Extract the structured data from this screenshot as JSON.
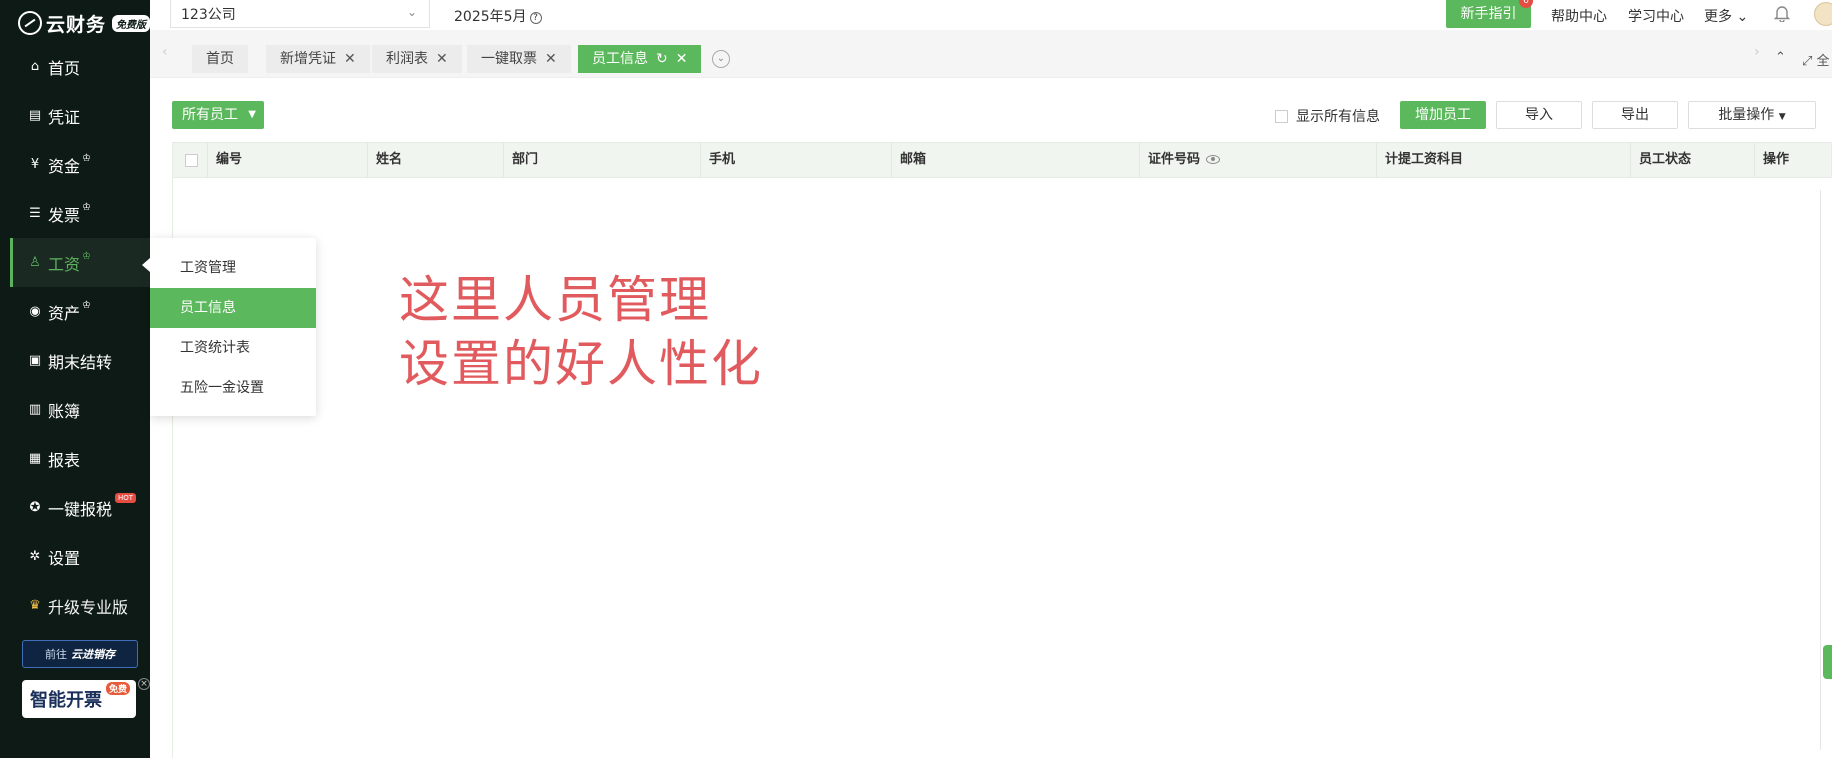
{
  "logo": {
    "name": "云财务",
    "badge": "免费版"
  },
  "sidebar": {
    "items": [
      {
        "label": "首页",
        "icon": "home-icon",
        "glyph": "⌂",
        "crown": false
      },
      {
        "label": "凭证",
        "icon": "voucher-icon",
        "glyph": "▤",
        "crown": false
      },
      {
        "label": "资金",
        "icon": "fund-icon",
        "glyph": "¥",
        "crown": true
      },
      {
        "label": "发票",
        "icon": "invoice-icon",
        "glyph": "☰",
        "crown": true
      },
      {
        "label": "工资",
        "icon": "salary-icon",
        "glyph": "♙",
        "crown": true,
        "active": true
      },
      {
        "label": "资产",
        "icon": "asset-icon",
        "glyph": "◉",
        "crown": true
      },
      {
        "label": "期末结转",
        "icon": "closing-icon",
        "glyph": "▣",
        "crown": false
      },
      {
        "label": "账簿",
        "icon": "ledger-icon",
        "glyph": "▥",
        "crown": false
      },
      {
        "label": "报表",
        "icon": "report-icon",
        "glyph": "▦",
        "crown": false
      },
      {
        "label": "一键报税",
        "icon": "tax-icon",
        "glyph": "✪",
        "crown": false,
        "hot": "HOT"
      },
      {
        "label": "设置",
        "icon": "settings-icon",
        "glyph": "✲",
        "crown": false
      },
      {
        "label": "升级专业版",
        "icon": "crown-icon",
        "glyph": "♛",
        "crown": false,
        "upgrade": true
      }
    ],
    "promo1": {
      "prefix": "前往",
      "name": "云进销存"
    },
    "promo2": {
      "text": "智能开票",
      "badge": "免费"
    }
  },
  "topbar": {
    "company": "123公司",
    "period": "2025年5月",
    "guide_button": "新手指引",
    "guide_badge": "6",
    "help": "帮助中心",
    "learn": "学习中心",
    "more": "更多"
  },
  "tabs": [
    {
      "label": "首页",
      "closable": false
    },
    {
      "label": "新增凭证",
      "closable": true
    },
    {
      "label": "利润表",
      "closable": true
    },
    {
      "label": "一键取票",
      "closable": true
    },
    {
      "label": "员工信息",
      "closable": true,
      "active": true
    }
  ],
  "tabbar_right": "全",
  "toolbar": {
    "filter": "所有员工",
    "show_all": "显示所有信息",
    "add": "增加员工",
    "import": "导入",
    "export": "导出",
    "batch": "批量操作"
  },
  "table": {
    "columns": [
      "编号",
      "姓名",
      "部门",
      "手机",
      "邮箱",
      "证件号码",
      "计提工资科目",
      "员工状态",
      "操作"
    ]
  },
  "submenu": {
    "items": [
      "工资管理",
      "员工信息",
      "工资统计表",
      "五险一金设置"
    ],
    "active_index": 1
  },
  "caption": {
    "line1": "这里人员管理",
    "line2": "设置的好人性化"
  },
  "colors": {
    "accent": "#5cb85c",
    "sidebar_bg": "#0e1a15",
    "caption": "#e05a5e"
  }
}
